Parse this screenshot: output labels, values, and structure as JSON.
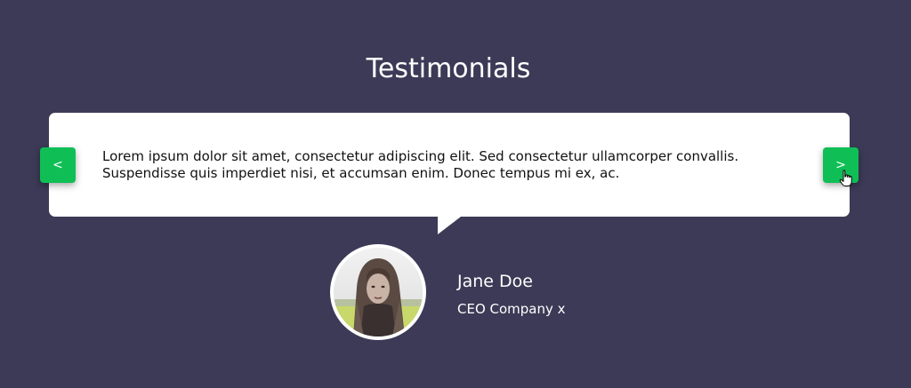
{
  "section": {
    "title": "Testimonials"
  },
  "testimonial": {
    "quote": "Lorem ipsum dolor sit amet, consectetur adipiscing elit. Sed consectetur ullamcorper convallis. Suspendisse quis imperdiet nisi, et accumsan enim. Donec tempus mi ex, ac.",
    "author_name": "Jane Doe",
    "author_role": "CEO Company x"
  },
  "nav": {
    "prev_label": "<",
    "next_label": ">"
  },
  "colors": {
    "background": "#3c3a56",
    "card": "#ffffff",
    "accent": "#0fbf55"
  },
  "icons": {
    "cursor": "hand-pointer-icon",
    "avatar": "person-photo"
  }
}
